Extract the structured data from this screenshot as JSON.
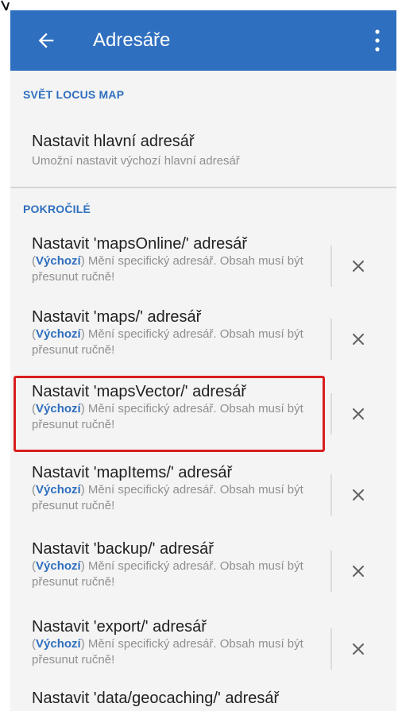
{
  "app": {
    "title": "Adresáře",
    "colors": {
      "appbar": "#2f6fbf",
      "accent": "#2f6fbf",
      "highlight": "#d91e1e",
      "background": "#f4f4f4"
    },
    "icons": {
      "back": "back-arrow-icon",
      "more": "more-vert-icon",
      "clear": "close-icon"
    }
  },
  "sections": {
    "world": {
      "title": "SVĚT LOCUS MAP",
      "item": {
        "title": "Nastavit hlavní adresář",
        "subtitle": "Umožní nastavit výchozí hlavní adresář"
      }
    },
    "advanced": {
      "title": "POKROČILÉ"
    }
  },
  "rows": [
    {
      "title": "Nastavit 'mapsOnline/' adresář",
      "default_label": "Výchozí",
      "desc_prefix": "(",
      "desc_suffix": ") Mění specifický adresář. Obsah musí být přesunut ručně!",
      "clear_label": "×"
    },
    {
      "title": "Nastavit 'maps/' adresář",
      "default_label": "Výchozí",
      "desc_prefix": "(",
      "desc_suffix": ") Mění specifický adresář. Obsah musí být přesunut ručně!",
      "clear_label": "×"
    },
    {
      "title": "Nastavit 'mapsVector/' adresář",
      "default_label": "Výchozí",
      "desc_prefix": "(",
      "desc_suffix": ") Mění specifický adresář. Obsah musí být přesunut ručně!",
      "clear_label": "×"
    },
    {
      "title": "Nastavit 'mapItems/' adresář",
      "default_label": "Výchozí",
      "desc_prefix": "(",
      "desc_suffix": ") Mění specifický adresář. Obsah musí být přesunut ručně!",
      "clear_label": "×"
    },
    {
      "title": "Nastavit 'backup/' adresář",
      "default_label": "Výchozí",
      "desc_prefix": "(",
      "desc_suffix": ") Mění specifický adresář. Obsah musí být přesunut ručně!",
      "clear_label": "×"
    },
    {
      "title": "Nastavit 'export/' adresář",
      "default_label": "Výchozí",
      "desc_prefix": "(",
      "desc_suffix": ") Mění specifický adresář. Obsah musí být přesunut ručně!",
      "clear_label": "×"
    }
  ],
  "partial_row": {
    "title": "Nastavit 'data/geocaching/' adresář"
  }
}
